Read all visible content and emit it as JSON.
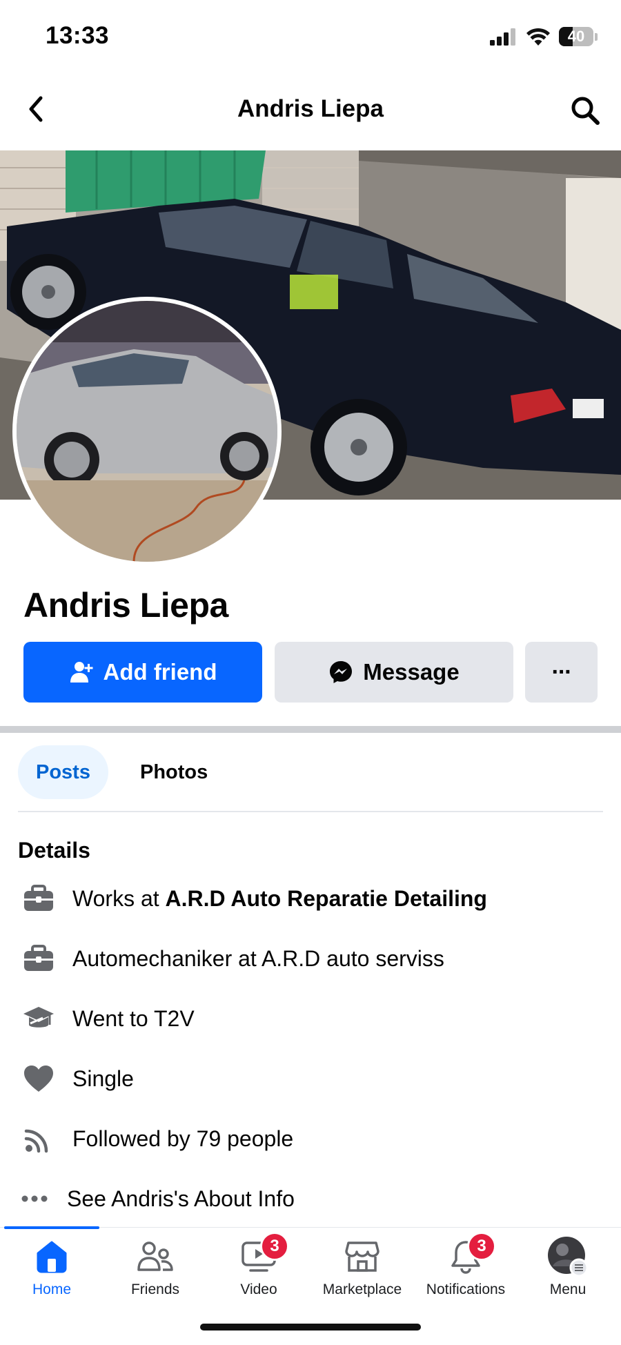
{
  "status_bar": {
    "time": "13:33",
    "battery_level": "40",
    "battery_fraction": 0.4
  },
  "header": {
    "title": "Andris Liepa"
  },
  "profile": {
    "name": "Andris Liepa",
    "cover_subject": "dark sedan car parked by garage",
    "avatar_subject": "silver estate car in workshop"
  },
  "actions": {
    "add_friend": "Add friend",
    "message": "Message",
    "more": "···"
  },
  "tabs": [
    {
      "label": "Posts",
      "active": true
    },
    {
      "label": "Photos",
      "active": false
    }
  ],
  "details": {
    "title": "Details",
    "items": [
      {
        "icon": "briefcase-icon",
        "prefix": "Works at ",
        "strong": "A.R.D Auto Reparatie Detailing"
      },
      {
        "icon": "briefcase-icon",
        "prefix": "Automechaniker at A.R.D auto serviss",
        "strong": ""
      },
      {
        "icon": "graduation-cap-icon",
        "prefix": "Went to T2V",
        "strong": ""
      },
      {
        "icon": "heart-icon",
        "prefix": "Single",
        "strong": ""
      },
      {
        "icon": "rss-icon",
        "prefix": "Followed by 79 people",
        "strong": ""
      },
      {
        "icon": "more-dots-icon",
        "prefix": "See Andris's About Info",
        "strong": ""
      }
    ]
  },
  "bottom_nav": {
    "items": [
      {
        "label": "Home",
        "icon": "home-icon",
        "active": true,
        "badge": ""
      },
      {
        "label": "Friends",
        "icon": "friends-icon",
        "active": false,
        "badge": ""
      },
      {
        "label": "Video",
        "icon": "video-icon",
        "active": false,
        "badge": "3"
      },
      {
        "label": "Marketplace",
        "icon": "marketplace-icon",
        "active": false,
        "badge": ""
      },
      {
        "label": "Notifications",
        "icon": "bell-icon",
        "active": false,
        "badge": "3"
      },
      {
        "label": "Menu",
        "icon": "menu-avatar",
        "active": false,
        "badge": ""
      }
    ]
  },
  "colors": {
    "accent": "#0866ff",
    "badge": "#e41e3f",
    "tab_active_bg": "#ebf5ff",
    "secondary_button": "#e4e6eb"
  }
}
